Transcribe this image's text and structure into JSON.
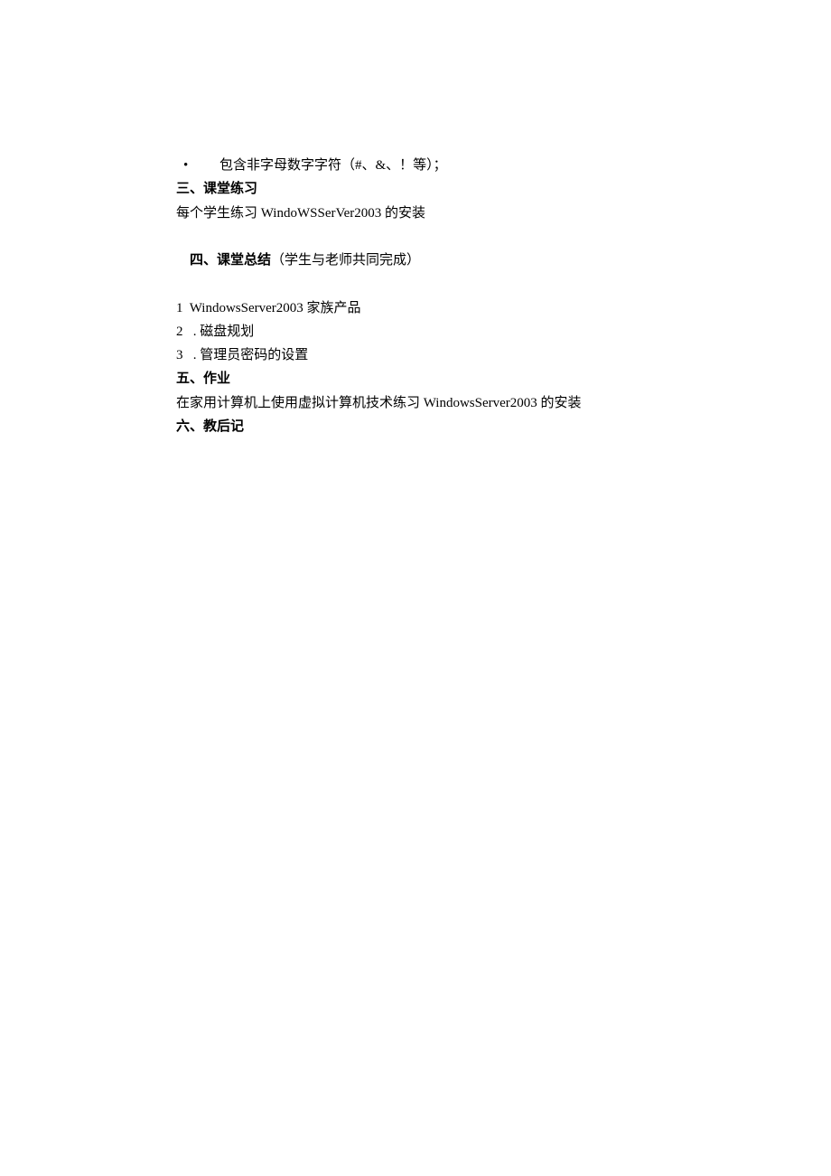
{
  "doc": {
    "bullet_dot": "•",
    "bullet_text": "包含非字母数字字符（#、&、！等）；",
    "section3_heading": "三、课堂练习",
    "section3_body": "每个学生练习 WindoWSSerVer2003 的安装",
    "section4_heading": "四、课堂总结",
    "section4_note": "（学生与老师共同完成）",
    "section4_item1": "1  WindowsServer2003 家族产品",
    "section4_item2": "2   . 磁盘规划",
    "section4_item3": "3   . 管理员密码的设置",
    "section5_heading": "五、作业",
    "section5_body": "在家用计算机上使用虚拟计算机技术练习 WindowsServer2003 的安装",
    "section6_heading": "六、教后记"
  }
}
